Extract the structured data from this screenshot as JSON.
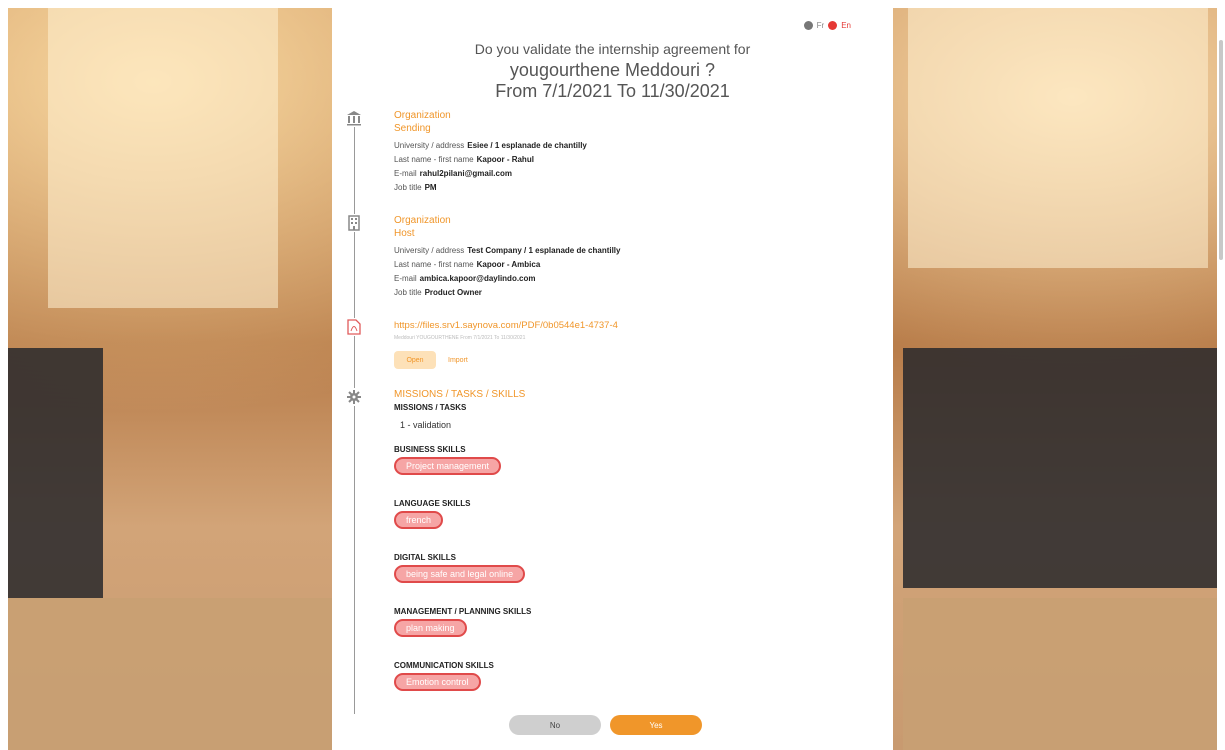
{
  "language_switch": {
    "fr": "Fr",
    "en": "En"
  },
  "header": {
    "line1": "Do you validate the internship agreement for",
    "line2": "yougourthene Meddouri ?",
    "line3": "From 7/1/2021 To 11/30/2021"
  },
  "sending": {
    "title": "Organization",
    "subtitle": "Sending",
    "rows": [
      {
        "label": "University / address",
        "value": "Esiee / 1 esplanade de chantilly"
      },
      {
        "label": "Last name - first name",
        "value": "Kapoor - Rahul"
      },
      {
        "label": "E-mail",
        "value": "rahul2pilani@gmail.com"
      },
      {
        "label": "Job title",
        "value": "PM"
      }
    ]
  },
  "host": {
    "title": "Organization",
    "subtitle": "Host",
    "rows": [
      {
        "label": "University / address",
        "value": "Test Company / 1 esplanade de chantilly"
      },
      {
        "label": "Last name - first name",
        "value": "Kapoor - Ambica"
      },
      {
        "label": "E-mail",
        "value": "ambica.kapoor@daylindo.com"
      },
      {
        "label": "Job title",
        "value": "Product Owner"
      }
    ]
  },
  "document": {
    "url": "https://files.srv1.saynova.com/PDF/0b0544e1-4737-4",
    "caption": "Meddouri YOUGOURTHENE From 7/1/2021 To 11/30/2021",
    "open_label": "Open",
    "import_label": "Import"
  },
  "skills": {
    "title": "MISSIONS / TASKS / SKILLS",
    "missions_heading": "MISSIONS / TASKS",
    "mission_item": "1 - validation",
    "groups": [
      {
        "heading": "BUSINESS SKILLS",
        "tag": "Project management"
      },
      {
        "heading": "LANGUAGE SKILLS",
        "tag": "french"
      },
      {
        "heading": "DIGITAL SKILLS",
        "tag": "being safe and legal online"
      },
      {
        "heading": "MANAGEMENT / PLANNING SKILLS",
        "tag": "plan making"
      },
      {
        "heading": "COMMUNICATION SKILLS",
        "tag": "Emotion control"
      }
    ]
  },
  "actions": {
    "no_label": "No",
    "yes_label": "Yes"
  }
}
